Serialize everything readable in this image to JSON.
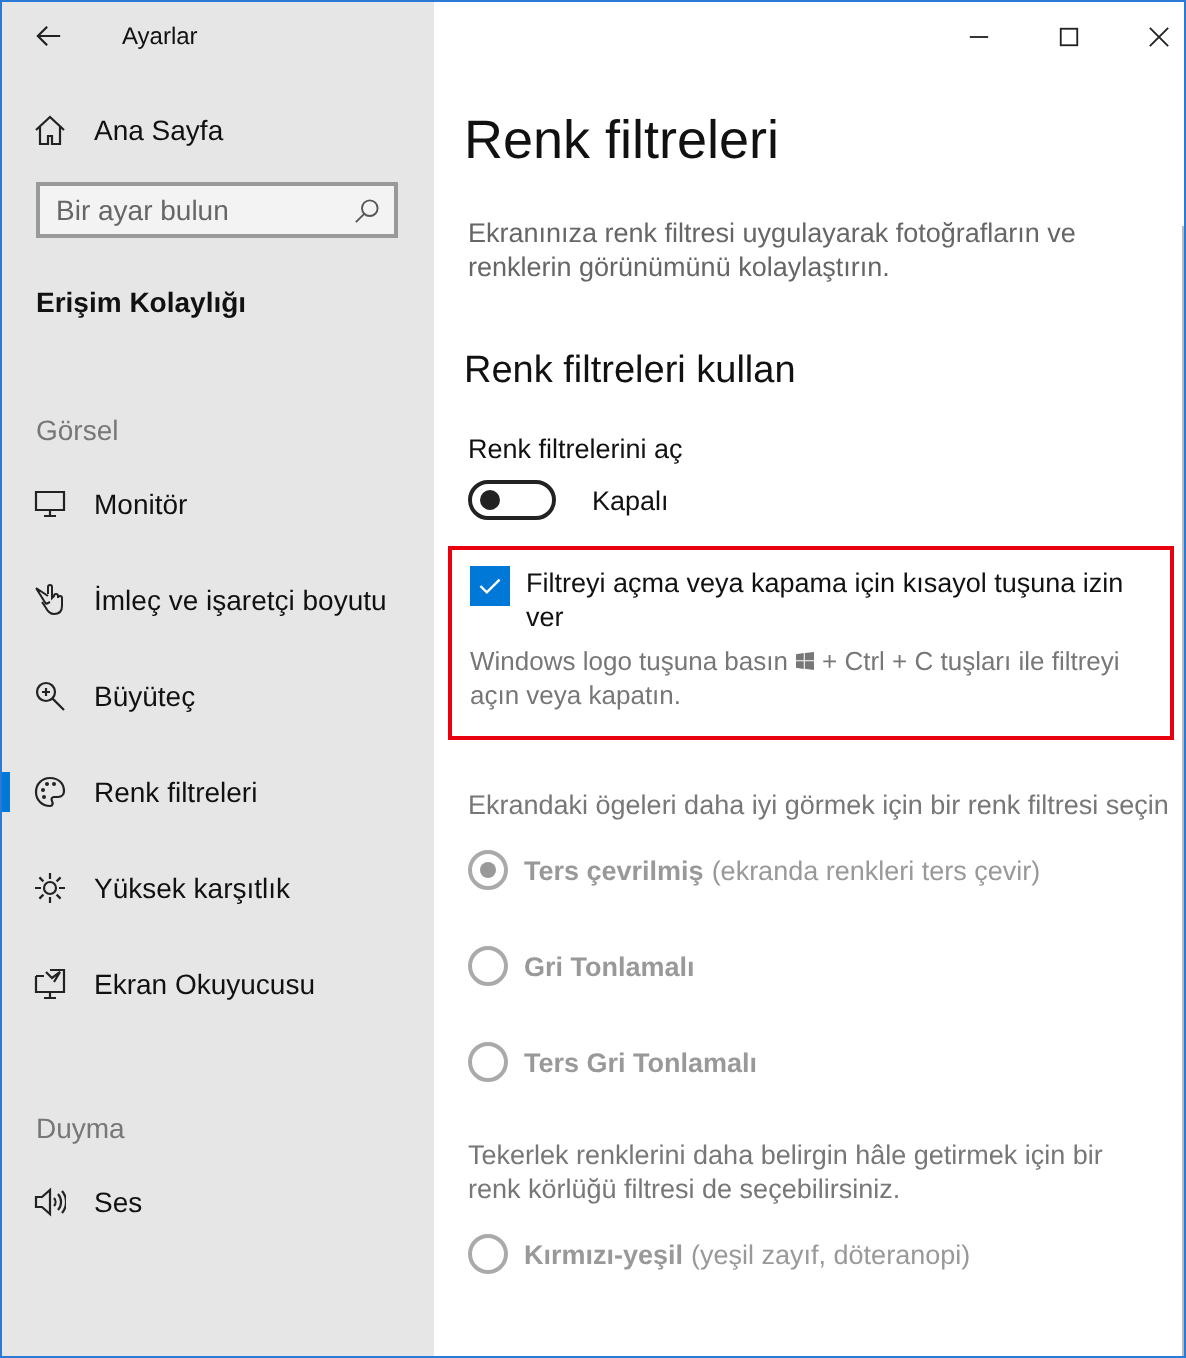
{
  "window": {
    "title": "Ayarlar"
  },
  "sidebar": {
    "home": "Ana Sayfa",
    "search": {
      "placeholder": "Bir ayar bulun"
    },
    "category": "Erişim Kolaylığı",
    "groups": [
      {
        "heading": "Görsel",
        "items": [
          {
            "label": "Monitör",
            "selected": false
          },
          {
            "label": "İmleç ve işaretçi boyutu",
            "selected": false
          },
          {
            "label": "Büyüteç",
            "selected": false
          },
          {
            "label": "Renk filtreleri",
            "selected": true
          },
          {
            "label": "Yüksek karşıtlık",
            "selected": false
          },
          {
            "label": "Ekran Okuyucusu",
            "selected": false
          }
        ]
      },
      {
        "heading": "Duyma",
        "items": [
          {
            "label": "Ses",
            "selected": false
          }
        ]
      }
    ]
  },
  "content": {
    "title": "Renk filtreleri",
    "description": "Ekranınıza renk filtresi uygulayarak fotoğrafların ve renklerin görünümünü kolaylaştırın.",
    "section": "Renk filtreleri kullan",
    "toggle": {
      "label": "Renk filtrelerini aç",
      "on": false,
      "state_text": "Kapalı"
    },
    "shortcut": {
      "highlighted": true,
      "checked": true,
      "label": "Filtreyi açma veya kapama için kısayol tuşuna izin ver",
      "hint_before": "Windows logo tuşuna basın",
      "hint_after": "+ Ctrl + C tuşları ile filtreyi",
      "hint_continued": "açın veya kapatın."
    },
    "filter_prompt": "Ekrandaki ögeleri daha iyi görmek için bir renk filtresi seçin",
    "filters": [
      {
        "name": "Ters çevrilmiş",
        "hint": "(ekranda renkleri ters çevir)",
        "selected": true,
        "disabled": true
      },
      {
        "name": "Gri Tonlamalı",
        "selected": false,
        "disabled": true
      },
      {
        "name": "Ters Gri Tonlamalı",
        "selected": false,
        "disabled": true
      }
    ],
    "colorblind_prompt": "Tekerlek renklerini daha belirgin hâle getirmek için bir renk körlüğü filtresi de seçebilirsiniz.",
    "colorblind_filters": [
      {
        "name": "Kırmızı-yeşil",
        "hint": "(yeşil zayıf, döteranopi)",
        "selected": false,
        "disabled": true
      }
    ]
  }
}
